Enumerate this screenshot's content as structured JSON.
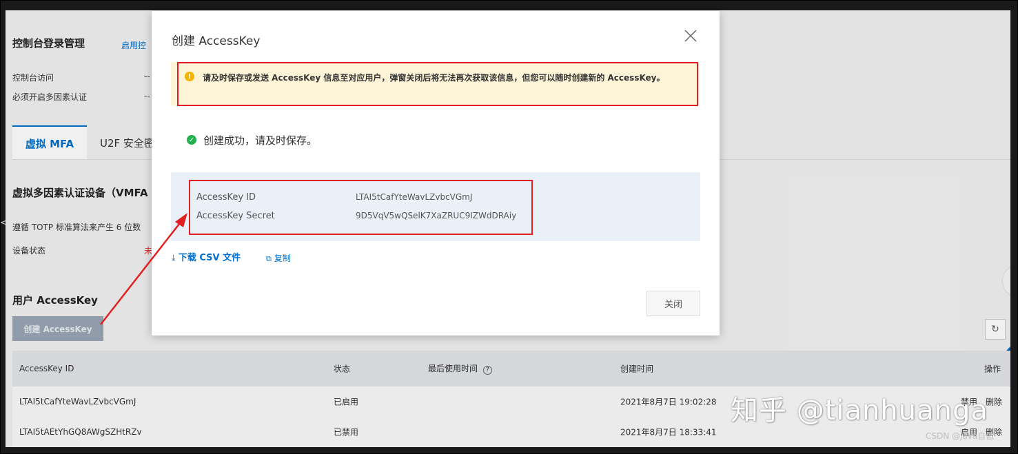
{
  "background": {
    "console_login": {
      "title": "控制台登录管理",
      "link_partial": "启用控",
      "rows": [
        {
          "label": "控制台访问",
          "value": "--"
        },
        {
          "label": "必须开启多因素认证",
          "value": "--"
        }
      ]
    },
    "tabs": [
      {
        "label": "虚拟 MFA",
        "active": true
      },
      {
        "label": "U2F 安全密",
        "active": false
      }
    ],
    "vmfa": {
      "title": "虚拟多因素认证设备（VMFA",
      "desc": "遵循 TOTP 标准算法来产生 6 位数",
      "status_label": "设备状态",
      "status_value": "未"
    },
    "access_key_section": {
      "title": "用户 AccessKey",
      "create_button": "创建 AccessKey"
    },
    "table": {
      "columns": [
        "AccessKey ID",
        "状态",
        "最后使用时间",
        "创建时间",
        "操作"
      ],
      "rows": [
        {
          "id": "LTAI5tCafYteWavLZvbcVGmJ",
          "status": "已启用",
          "last_used": "",
          "created": "2021年8月7日 19:02:28",
          "actions": [
            "禁用",
            "删除"
          ]
        },
        {
          "id": "LTAI5tAEtYhGQ8AWgSZHtRZv",
          "status": "已禁用",
          "last_used": "",
          "created": "2021年8月7日 18:33:41",
          "actions": [
            "启用",
            "删除"
          ]
        }
      ]
    }
  },
  "modal": {
    "title": "创建 AccessKey",
    "warning": "请及时保存或发送 AccessKey 信息至对应用户，弹窗关闭后将无法再次获取该信息，但您可以随时创建新的 AccessKey。",
    "success": "创建成功，请及时保存。",
    "key_id_label": "AccessKey ID",
    "key_id_value": "LTAI5tCafYteWavLZvbcVGmJ",
    "key_secret_label": "AccessKey Secret",
    "key_secret_value": "9D5VqV5wQSelK7XaZRUC9IZWdDRAiy",
    "download_label": "下载 CSV 文件",
    "copy_label": "复制",
    "close_button": "关闭"
  },
  "watermarks": {
    "zhihu": "知乎 @tianhuanga",
    "csdn": "CSDN @java自傲"
  },
  "colors": {
    "accent": "#0070cc",
    "warning_bg": "#fdf3d6",
    "key_bg": "#e9f0f8",
    "highlight": "#e02020",
    "success": "#22b14c"
  }
}
